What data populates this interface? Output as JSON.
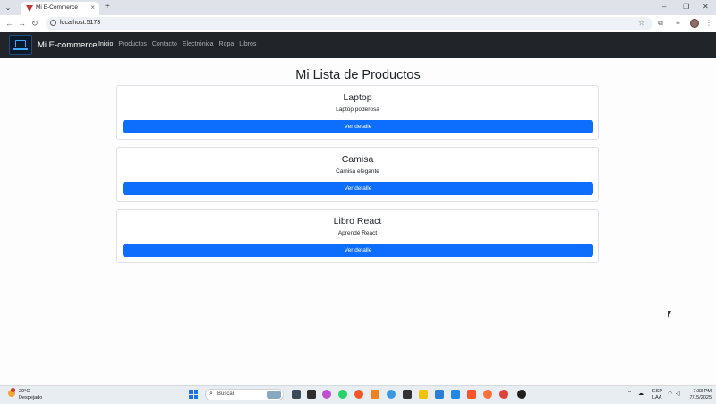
{
  "browser": {
    "tab_title": "Mi E-Commerce",
    "tab_close": "×",
    "new_tab": "+",
    "url": "localhost:5173",
    "controls": {
      "minimize": "–",
      "maximize": "❐",
      "close": "✕"
    }
  },
  "navbar": {
    "brand": "Mi E-commerce",
    "links": [
      "Inicio",
      "Productos",
      "Contacto",
      "Electrónica",
      "Ropa",
      "Libros"
    ],
    "active": "Inicio"
  },
  "main": {
    "title": "Mi Lista de Productos",
    "products": [
      {
        "name": "Laptop",
        "description": "Laptop poderosa",
        "button": "Ver detalle"
      },
      {
        "name": "Camisa",
        "description": "Camisa elegante",
        "button": "Ver detalle"
      },
      {
        "name": "Libro React",
        "description": "Aprendé React",
        "button": "Ver detalle"
      }
    ]
  },
  "taskbar": {
    "weather": {
      "temp": "20°C",
      "desc": "Despejado",
      "badge": "1"
    },
    "search_label": "Buscar",
    "lang": "ESP",
    "lang_sub": "LAA",
    "time": "7:33 PM",
    "date": "7/15/2025"
  },
  "colors": {
    "navbar_bg": "#212529",
    "primary": "#0d6efd",
    "page_bg": "#fdfdfe"
  }
}
